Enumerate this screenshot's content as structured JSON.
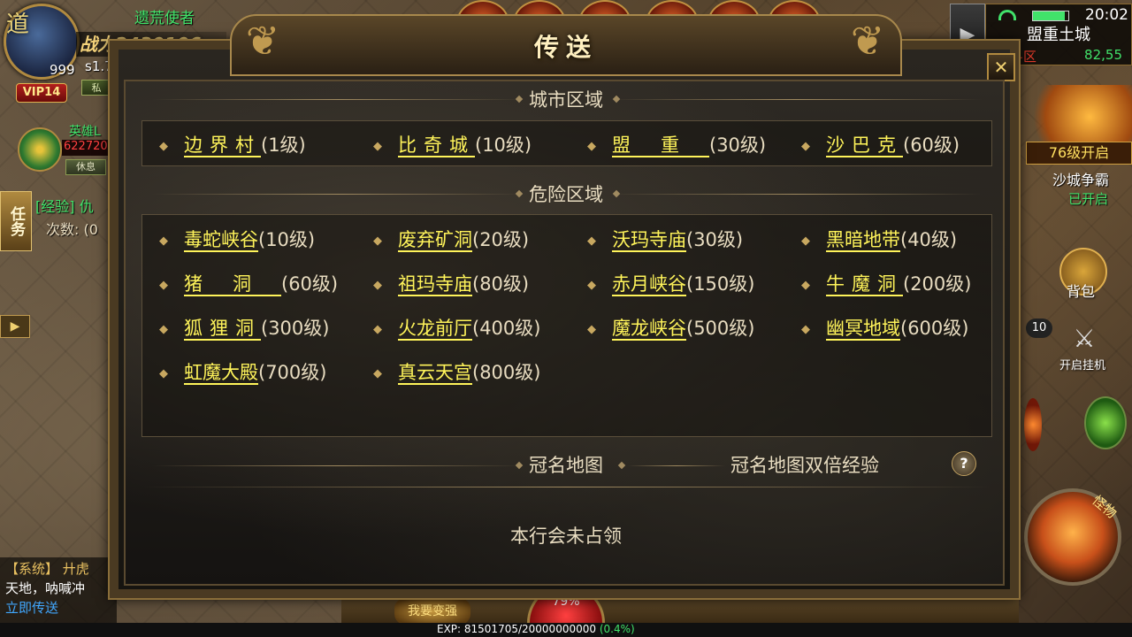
{
  "hud": {
    "avatar_glyph": "道",
    "level": "999",
    "vip": "VIP14",
    "player_name": "遗荒使者",
    "power": "战力2430106",
    "s_label": "s1.7",
    "side_btn": "私",
    "pet_name": "英雄L",
    "pet_hp": "622720",
    "pet_rest": "休息",
    "task_tab": "任务",
    "task_line1": "[经验] 仇",
    "task_line2": "次数: (0",
    "side_arrow": "▶",
    "chat_sys": "【系统】 廾虎",
    "chat_text": "天地，呐喊冲",
    "chat_link": "立即传送"
  },
  "status": {
    "clock": "20:02",
    "map_name": "盟重土城",
    "map_zone": "战斗区",
    "map_coords": "82,55",
    "battery_level": 0.9,
    "expand": "▶"
  },
  "right_panel": {
    "badge_level": "76级开启",
    "sand_title": "沙城争霸",
    "sand_sub": "已开启",
    "bag_label": "背包",
    "count": "10",
    "hook_label": "开启挂机",
    "monster_label": "怪物"
  },
  "bottom": {
    "hp_percent": "79%",
    "strong_btn": "我要变强",
    "exp_text": "EXP: 81501705/20000000000",
    "exp_pct": "(0.4%)"
  },
  "dialog": {
    "title": "传送",
    "close": "✕",
    "city_section": "城市区域",
    "danger_section": "危险区域",
    "crown_section": "冠名地图",
    "crown_double": "冠名地图双倍经验",
    "help": "?",
    "guild_status": "本行会未占领",
    "city": [
      {
        "name": "边界村",
        "level": "(1级)"
      },
      {
        "name": "比奇城",
        "level": "(10级)"
      },
      {
        "name": "盟重",
        "level": "(30级)"
      },
      {
        "name": "沙巴克",
        "level": "(60级)"
      }
    ],
    "danger": [
      {
        "name": "毒蛇峡谷",
        "level": "(10级)"
      },
      {
        "name": "废弃矿洞",
        "level": "(20级)"
      },
      {
        "name": "沃玛寺庙",
        "level": "(30级)"
      },
      {
        "name": "黑暗地带",
        "level": "(40级)"
      },
      {
        "name": "猪洞",
        "level": "(60级)"
      },
      {
        "name": "祖玛寺庙",
        "level": "(80级)"
      },
      {
        "name": "赤月峡谷",
        "level": "(150级)"
      },
      {
        "name": "牛魔洞",
        "level": "(200级)"
      },
      {
        "name": "狐狸洞",
        "level": "(300级)"
      },
      {
        "name": "火龙前厅",
        "level": "(400级)"
      },
      {
        "name": "魔龙峡谷",
        "level": "(500级)"
      },
      {
        "name": "幽冥地域",
        "level": "(600级)"
      },
      {
        "name": "虹魔大殿",
        "level": "(700级)"
      },
      {
        "name": "真云天宫",
        "level": "(800级)"
      }
    ]
  }
}
